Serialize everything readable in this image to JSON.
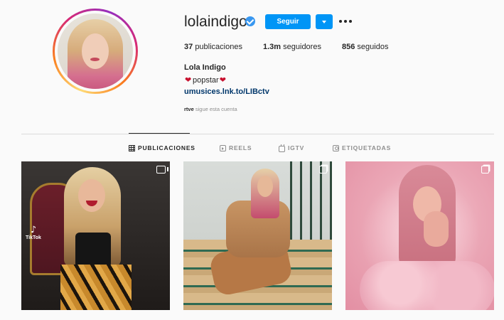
{
  "profile": {
    "username": "lolaindigo",
    "verified": true,
    "follow_label": "Seguir",
    "full_name": "Lola Indigo",
    "bio_text": "popstar",
    "link": "umusices.lnk.to/LIBctv",
    "followed_by_user": "rtve",
    "followed_by_text": "sigue esta cuenta"
  },
  "stats": {
    "posts_count": "37",
    "posts_label": "publicaciones",
    "followers_count": "1.3m",
    "followers_label": "seguidores",
    "following_count": "856",
    "following_label": "seguidos"
  },
  "tabs": [
    {
      "label": "PUBLICACIONES",
      "icon": "grid-icon",
      "active": true
    },
    {
      "label": "REELS",
      "icon": "reels-icon",
      "active": false
    },
    {
      "label": "IGTV",
      "icon": "igtv-icon",
      "active": false
    },
    {
      "label": "ETIQUETADAS",
      "icon": "tagged-icon",
      "active": false
    }
  ],
  "posts": [
    {
      "overlay_icon": "reel-icon",
      "watermark": "TikTok"
    },
    {
      "overlay_icon": "carousel-icon"
    },
    {
      "overlay_icon": "carousel-icon"
    }
  ],
  "colors": {
    "accent": "#0095f6",
    "verified": "#3897f0",
    "link": "#00376b",
    "muted": "#8e8e8e"
  }
}
